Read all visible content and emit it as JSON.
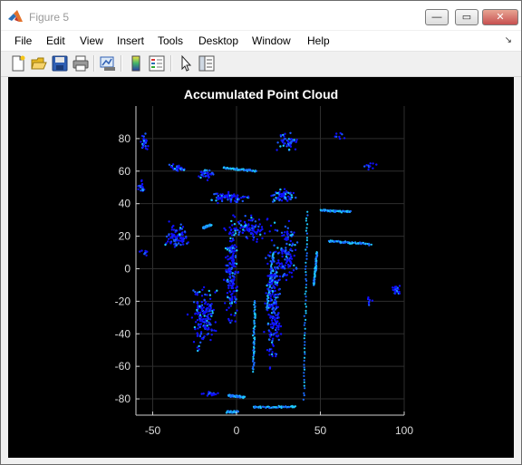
{
  "window": {
    "title": "Figure 5"
  },
  "controls": {
    "minimize": "—",
    "maximize": "▭",
    "close": "✕"
  },
  "menu": [
    "File",
    "Edit",
    "View",
    "Insert",
    "Tools",
    "Desktop",
    "Window",
    "Help"
  ],
  "toolbar": [
    "new-figure",
    "open-file",
    "save-figure",
    "print-figure",
    "link-plot",
    "insert-colorbar",
    "insert-legend",
    "edit-plot",
    "property-inspector"
  ],
  "chart_data": {
    "type": "scatter",
    "title": "Accumulated Point Cloud",
    "xlim": [
      -60,
      100
    ],
    "ylim": [
      -90,
      100
    ],
    "xticks": [
      -50,
      0,
      50,
      100
    ],
    "yticks": [
      -80,
      -60,
      -40,
      -20,
      0,
      20,
      40,
      60,
      80
    ],
    "grid": true,
    "background": "#000000",
    "colors": {
      "low": "#1010ff",
      "high": "#1ec8ff"
    },
    "series": [
      {
        "shape": "line",
        "from": [
          -6,
          -88
        ],
        "to": [
          1,
          -88
        ]
      },
      {
        "shape": "line",
        "from": [
          10,
          -85
        ],
        "to": [
          35,
          -85
        ]
      },
      {
        "shape": "line",
        "from": [
          -5,
          -78
        ],
        "to": [
          5,
          -79
        ]
      },
      {
        "shape": "line",
        "from": [
          10,
          -63
        ],
        "to": [
          11,
          -20
        ]
      },
      {
        "shape": "line",
        "from": [
          18,
          -25
        ],
        "to": [
          22,
          10
        ]
      },
      {
        "shape": "line",
        "from": [
          40,
          -80
        ],
        "to": [
          42,
          35
        ]
      },
      {
        "shape": "line",
        "from": [
          46,
          -10
        ],
        "to": [
          48,
          10
        ]
      },
      {
        "shape": "line",
        "from": [
          -8,
          62
        ],
        "to": [
          12,
          60
        ]
      },
      {
        "shape": "line",
        "from": [
          50,
          36
        ],
        "to": [
          68,
          35
        ]
      },
      {
        "shape": "line",
        "from": [
          55,
          17
        ],
        "to": [
          80,
          15
        ]
      },
      {
        "shape": "line",
        "from": [
          -20,
          25
        ],
        "to": [
          -15,
          27
        ]
      },
      {
        "shape": "cluster",
        "center": [
          -55,
          78
        ],
        "spread": [
          4,
          6
        ],
        "n": 25
      },
      {
        "shape": "cluster",
        "center": [
          -57,
          50
        ],
        "spread": [
          3,
          6
        ],
        "n": 18
      },
      {
        "shape": "cluster",
        "center": [
          -35,
          62
        ],
        "spread": [
          6,
          3
        ],
        "n": 30
      },
      {
        "shape": "cluster",
        "center": [
          -18,
          58
        ],
        "spread": [
          6,
          4
        ],
        "n": 35
      },
      {
        "shape": "cluster",
        "center": [
          -5,
          44
        ],
        "spread": [
          15,
          5
        ],
        "n": 70
      },
      {
        "shape": "cluster",
        "center": [
          30,
          78
        ],
        "spread": [
          8,
          8
        ],
        "n": 45
      },
      {
        "shape": "cluster",
        "center": [
          28,
          45
        ],
        "spread": [
          10,
          5
        ],
        "n": 60
      },
      {
        "shape": "cluster",
        "center": [
          -35,
          20
        ],
        "spread": [
          10,
          10
        ],
        "n": 80
      },
      {
        "shape": "cluster",
        "center": [
          -20,
          -30
        ],
        "spread": [
          10,
          25
        ],
        "n": 160
      },
      {
        "shape": "cluster",
        "center": [
          -3,
          0
        ],
        "spread": [
          5,
          45
        ],
        "n": 180
      },
      {
        "shape": "cluster",
        "center": [
          22,
          -20
        ],
        "spread": [
          6,
          55
        ],
        "n": 220
      },
      {
        "shape": "cluster",
        "center": [
          30,
          10
        ],
        "spread": [
          8,
          25
        ],
        "n": 120
      },
      {
        "shape": "cluster",
        "center": [
          8,
          25
        ],
        "spread": [
          15,
          10
        ],
        "n": 90
      },
      {
        "shape": "cluster",
        "center": [
          -55,
          10
        ],
        "spread": [
          4,
          4
        ],
        "n": 10
      },
      {
        "shape": "cluster",
        "center": [
          95,
          -13
        ],
        "spread": [
          5,
          4
        ],
        "n": 25
      },
      {
        "shape": "cluster",
        "center": [
          80,
          -20
        ],
        "spread": [
          3,
          4
        ],
        "n": 8
      },
      {
        "shape": "cluster",
        "center": [
          -15,
          -77
        ],
        "spread": [
          6,
          2
        ],
        "n": 18
      },
      {
        "shape": "cluster",
        "center": [
          80,
          63
        ],
        "spread": [
          4,
          4
        ],
        "n": 10
      },
      {
        "shape": "cluster",
        "center": [
          60,
          82
        ],
        "spread": [
          5,
          3
        ],
        "n": 8
      }
    ]
  }
}
